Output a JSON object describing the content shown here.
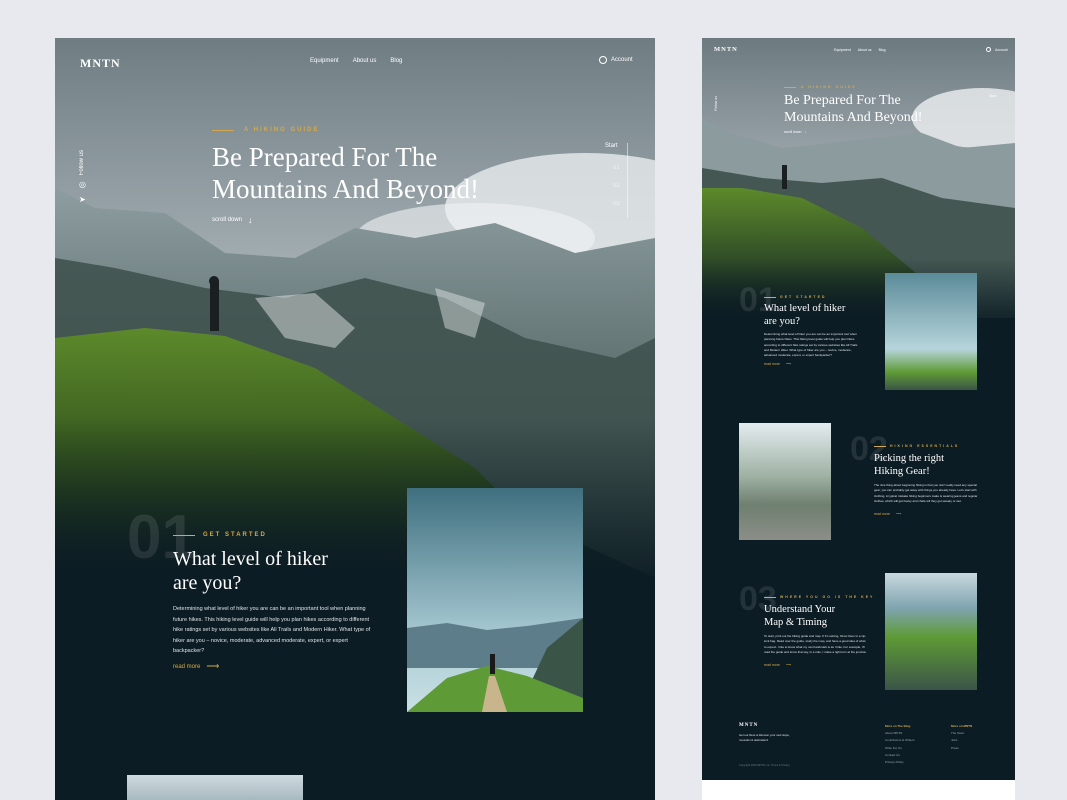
{
  "brand": "MNTN",
  "nav": {
    "links": [
      "Equipment",
      "About us",
      "Blog"
    ],
    "account": "Account"
  },
  "hero": {
    "eyebrow": "A HIKING GUIDE",
    "title_line1": "Be Prepared For The",
    "title_line2": "Mountains And Beyond!",
    "scroll": "scroll down",
    "follow": "Follow us",
    "slider_label": "Start",
    "slider_items": [
      "01",
      "02",
      "03"
    ]
  },
  "sections": [
    {
      "number": "01",
      "eyebrow": "GET STARTED",
      "title_line1": "What level of hiker",
      "title_line2": "are you?",
      "body": "Determining what level of hiker you are can be an important tool when planning future hikes. This hiking level guide will help you plan hikes according to different hike ratings set by various websites like All Trails and Modern Hiker. What type of hiker are you – novice, moderate, advanced moderate, expert, or expert backpacker?",
      "link": "read more"
    },
    {
      "number": "02",
      "eyebrow": "HIKING ESSENTIALS",
      "title_line1": "Picking the right",
      "title_line2": "Hiking Gear!",
      "body": "The nice thing about beginning hiking is that you don't really need any special gear, you can probably get away with things you already have. Let's start with clothing. A typical mistake hiking beginners make is wearing jeans and regular clothes, which will get heavy and chafe wif they get sweaty or wet.",
      "link": "read more"
    },
    {
      "number": "03",
      "eyebrow": "WHERE YOU GO IS THE KEY",
      "title_line1": "Understand Your",
      "title_line2": "Map & Timing",
      "body": "To start, print out the hiking guide and map. If it's raining, throw them in a zip-lock bag. Read over the guide, study the map, and have a good idea of what to expect. I like to know what my next landmark is as I hike. For example, I'll read the guide and know that say, in a mile, I make a right turn at the junction.",
      "link": "read more"
    }
  ],
  "footer": {
    "tagline": "Get out there & discover your next slope, mountain & destination!",
    "copyright": "Copyright 2023 MNTN, Inc. Terms & Privacy",
    "col1_title": "More on The Blog",
    "col1_items": [
      "About MNTN",
      "Contributors & Writers",
      "Write For Us",
      "Contact Us",
      "Privacy Policy"
    ],
    "col2_title": "More on MNTN",
    "col2_items": [
      "The Team",
      "Jobs",
      "Press"
    ]
  },
  "colors": {
    "background": "#0c1c24",
    "accent": "#d4a94b",
    "canvas": "#e7e9ee"
  },
  "icons": [
    "account-icon",
    "instagram-icon",
    "twitter-icon",
    "arrow-down-icon",
    "arrow-right-icon"
  ]
}
